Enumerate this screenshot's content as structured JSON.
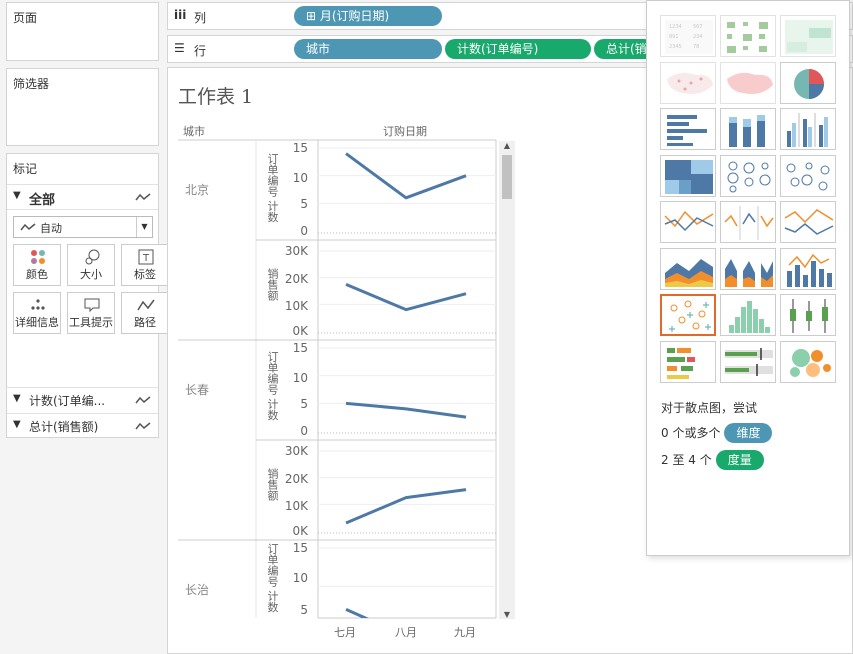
{
  "pages_card": {
    "title": "页面"
  },
  "filters_card": {
    "title": "筛选器"
  },
  "marks_card": {
    "title": "标记",
    "all_label": "全部",
    "mark_type": "自动",
    "buttons": [
      "颜色",
      "大小",
      "标签",
      "详细信息",
      "工具提示",
      "路径"
    ],
    "pills": [
      "计数(订单编...",
      "总计(销售额)"
    ]
  },
  "columns_shelf": {
    "name": "列",
    "pills": [
      "月(订购日期)"
    ]
  },
  "rows_shelf": {
    "name": "行",
    "pills": [
      "城市",
      "计数(订单编号)",
      "总计(销"
    ]
  },
  "worksheet": {
    "title": "工作表 1",
    "col_header_city": "城市",
    "col_header_date": "订购日期",
    "count_axis_label": "订单编号 计数",
    "sales_axis_label": "销售额",
    "count_ticks": [
      "15",
      "10",
      "5",
      "0"
    ],
    "sales_ticks": [
      "30K",
      "20K",
      "10K",
      "0K"
    ],
    "x_ticks": [
      "七月",
      "八月",
      "九月"
    ],
    "cities": [
      "北京",
      "长春",
      "长治"
    ]
  },
  "chart_data": {
    "type": "line",
    "categories": [
      "七月",
      "八月",
      "九月"
    ],
    "panels": [
      {
        "city": "北京",
        "measure": "计数(订单编号)",
        "values": [
          14,
          6,
          10
        ],
        "ylim": [
          0,
          15
        ]
      },
      {
        "city": "北京",
        "measure": "总计(销售额)",
        "values": [
          17500,
          8000,
          14000
        ],
        "ylim": [
          0,
          30000
        ]
      },
      {
        "city": "长春",
        "measure": "计数(订单编号)",
        "values": [
          5,
          4,
          2.5
        ],
        "ylim": [
          0,
          15
        ]
      },
      {
        "city": "长春",
        "measure": "总计(销售额)",
        "values": [
          3000,
          12500,
          15500
        ],
        "ylim": [
          0,
          30000
        ]
      },
      {
        "city": "长治",
        "measure": "计数(订单编号)",
        "values": [
          7,
          3.5,
          null
        ],
        "ylim": [
          0,
          15
        ]
      }
    ],
    "line_color": "#4e79a7"
  },
  "show_me": {
    "hint_line1": "对于散点图，尝试",
    "hint_line2_prefix": "0 个或多个",
    "hint_line2_pill": "维度",
    "hint_line3_prefix": "2 至 4 个",
    "hint_line3_pill": "度量",
    "selected": "scatter"
  },
  "colors": {
    "dimension": "#4e97b4",
    "measure": "#1aa96d",
    "selected_border": "#e06a2c"
  }
}
